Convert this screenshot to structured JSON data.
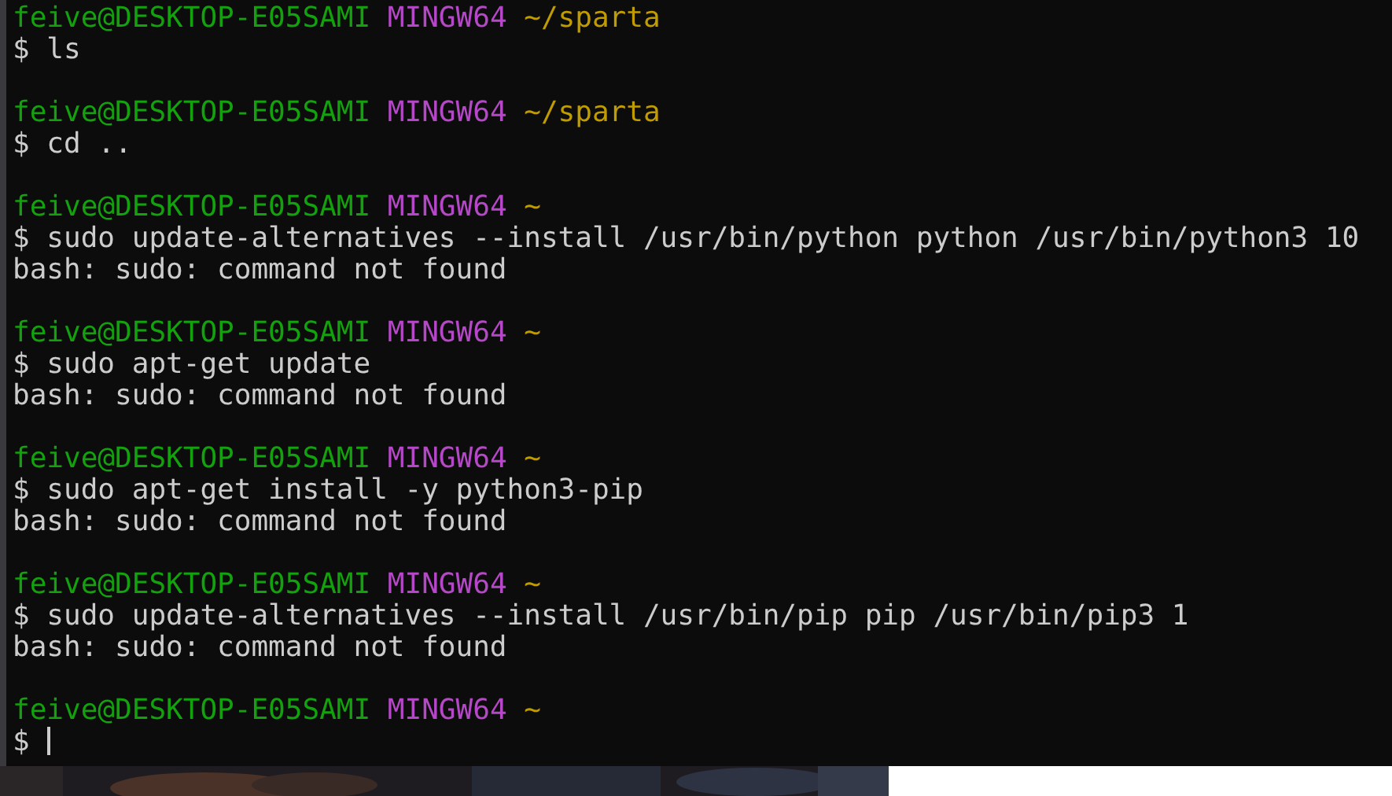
{
  "terminal": {
    "blocks": [
      {
        "user_host": "feive@DESKTOP-E05SAMI",
        "system": "MINGW64",
        "path": "~/sparta",
        "command": "$ ls"
      },
      {
        "user_host": "feive@DESKTOP-E05SAMI",
        "system": "MINGW64",
        "path": "~/sparta",
        "command": "$ cd .."
      },
      {
        "user_host": "feive@DESKTOP-E05SAMI",
        "system": "MINGW64",
        "path": "~",
        "command": "$ sudo update-alternatives --install /usr/bin/python python /usr/bin/python3 10",
        "output": [
          "bash: sudo: command not found"
        ]
      },
      {
        "user_host": "feive@DESKTOP-E05SAMI",
        "system": "MINGW64",
        "path": "~",
        "command": "$ sudo apt-get update",
        "output": [
          "bash: sudo: command not found"
        ]
      },
      {
        "user_host": "feive@DESKTOP-E05SAMI",
        "system": "MINGW64",
        "path": "~",
        "command": "$ sudo apt-get install -y python3-pip",
        "output": [
          "bash: sudo: command not found"
        ]
      },
      {
        "user_host": "feive@DESKTOP-E05SAMI",
        "system": "MINGW64",
        "path": "~",
        "command": "$ sudo update-alternatives --install /usr/bin/pip pip /usr/bin/pip3 1",
        "output": [
          "bash: sudo: command not found"
        ]
      },
      {
        "user_host": "feive@DESKTOP-E05SAMI",
        "system": "MINGW64",
        "path": "~",
        "command": "$",
        "cursor": true
      }
    ]
  }
}
